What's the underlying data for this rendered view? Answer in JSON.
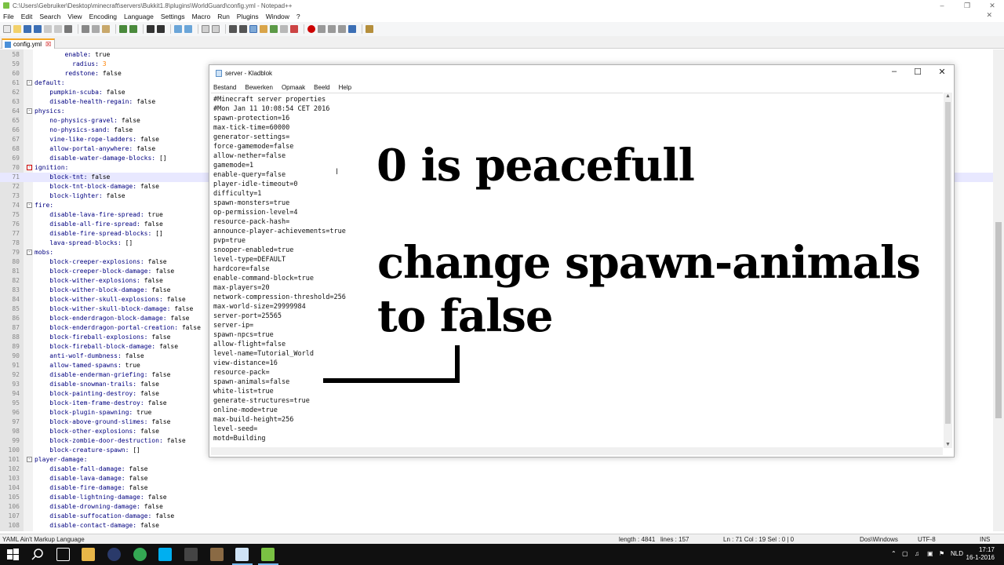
{
  "npp": {
    "title": "C:\\Users\\Gebruiker\\Desktop\\minecraft\\servers\\Bukkit1.8\\plugins\\WorldGuard\\config.yml - Notepad++",
    "menu": [
      "File",
      "Edit",
      "Search",
      "View",
      "Encoding",
      "Language",
      "Settings",
      "Macro",
      "Run",
      "Plugins",
      "Window",
      "?"
    ],
    "tab": "config.yml",
    "lines": [
      {
        "n": "58",
        "indent": "        ",
        "key": "enable",
        "val": "true",
        "type": "b"
      },
      {
        "n": "59",
        "indent": "          ",
        "key": "radius",
        "val": "3",
        "type": "num"
      },
      {
        "n": "60",
        "indent": "        ",
        "key": "redstone",
        "val": "false",
        "type": "b"
      },
      {
        "n": "61",
        "indent": "",
        "key": "default",
        "val": "",
        "fold": "-"
      },
      {
        "n": "62",
        "indent": "    ",
        "key": "pumpkin-scuba",
        "val": "false"
      },
      {
        "n": "63",
        "indent": "    ",
        "key": "disable-health-regain",
        "val": "false"
      },
      {
        "n": "64",
        "indent": "",
        "key": "physics",
        "val": "",
        "fold": "-"
      },
      {
        "n": "65",
        "indent": "    ",
        "key": "no-physics-gravel",
        "val": "false"
      },
      {
        "n": "66",
        "indent": "    ",
        "key": "no-physics-sand",
        "val": "false"
      },
      {
        "n": "67",
        "indent": "    ",
        "key": "vine-like-rope-ladders",
        "val": "false"
      },
      {
        "n": "68",
        "indent": "    ",
        "key": "allow-portal-anywhere",
        "val": "false"
      },
      {
        "n": "69",
        "indent": "    ",
        "key": "disable-water-damage-blocks",
        "val": "[]"
      },
      {
        "n": "70",
        "indent": "",
        "key": "ignition",
        "val": "",
        "fold": "-",
        "red": true
      },
      {
        "n": "71",
        "indent": "    ",
        "key": "block-tnt",
        "val": "false",
        "cur": true
      },
      {
        "n": "72",
        "indent": "    ",
        "key": "block-tnt-block-damage",
        "val": "false"
      },
      {
        "n": "73",
        "indent": "    ",
        "key": "block-lighter",
        "val": "false"
      },
      {
        "n": "74",
        "indent": "",
        "key": "fire",
        "val": "",
        "fold": "-"
      },
      {
        "n": "75",
        "indent": "    ",
        "key": "disable-lava-fire-spread",
        "val": "true"
      },
      {
        "n": "76",
        "indent": "    ",
        "key": "disable-all-fire-spread",
        "val": "false"
      },
      {
        "n": "77",
        "indent": "    ",
        "key": "disable-fire-spread-blocks",
        "val": "[]"
      },
      {
        "n": "78",
        "indent": "    ",
        "key": "lava-spread-blocks",
        "val": "[]"
      },
      {
        "n": "79",
        "indent": "",
        "key": "mobs",
        "val": "",
        "fold": "-"
      },
      {
        "n": "80",
        "indent": "    ",
        "key": "block-creeper-explosions",
        "val": "false"
      },
      {
        "n": "81",
        "indent": "    ",
        "key": "block-creeper-block-damage",
        "val": "false"
      },
      {
        "n": "82",
        "indent": "    ",
        "key": "block-wither-explosions",
        "val": "false"
      },
      {
        "n": "83",
        "indent": "    ",
        "key": "block-wither-block-damage",
        "val": "false"
      },
      {
        "n": "84",
        "indent": "    ",
        "key": "block-wither-skull-explosions",
        "val": "false"
      },
      {
        "n": "85",
        "indent": "    ",
        "key": "block-wither-skull-block-damage",
        "val": "false"
      },
      {
        "n": "86",
        "indent": "    ",
        "key": "block-enderdragon-block-damage",
        "val": "false"
      },
      {
        "n": "87",
        "indent": "    ",
        "key": "block-enderdragon-portal-creation",
        "val": "false"
      },
      {
        "n": "88",
        "indent": "    ",
        "key": "block-fireball-explosions",
        "val": "false"
      },
      {
        "n": "89",
        "indent": "    ",
        "key": "block-fireball-block-damage",
        "val": "false"
      },
      {
        "n": "90",
        "indent": "    ",
        "key": "anti-wolf-dumbness",
        "val": "false"
      },
      {
        "n": "91",
        "indent": "    ",
        "key": "allow-tamed-spawns",
        "val": "true"
      },
      {
        "n": "92",
        "indent": "    ",
        "key": "disable-enderman-griefing",
        "val": "false"
      },
      {
        "n": "93",
        "indent": "    ",
        "key": "disable-snowman-trails",
        "val": "false"
      },
      {
        "n": "94",
        "indent": "    ",
        "key": "block-painting-destroy",
        "val": "false"
      },
      {
        "n": "95",
        "indent": "    ",
        "key": "block-item-frame-destroy",
        "val": "false"
      },
      {
        "n": "96",
        "indent": "    ",
        "key": "block-plugin-spawning",
        "val": "true"
      },
      {
        "n": "97",
        "indent": "    ",
        "key": "block-above-ground-slimes",
        "val": "false"
      },
      {
        "n": "98",
        "indent": "    ",
        "key": "block-other-explosions",
        "val": "false"
      },
      {
        "n": "99",
        "indent": "    ",
        "key": "block-zombie-door-destruction",
        "val": "false"
      },
      {
        "n": "100",
        "indent": "    ",
        "key": "block-creature-spawn",
        "val": "[]"
      },
      {
        "n": "101",
        "indent": "",
        "key": "player-damage",
        "val": "",
        "fold": "-"
      },
      {
        "n": "102",
        "indent": "    ",
        "key": "disable-fall-damage",
        "val": "false"
      },
      {
        "n": "103",
        "indent": "    ",
        "key": "disable-lava-damage",
        "val": "false"
      },
      {
        "n": "104",
        "indent": "    ",
        "key": "disable-fire-damage",
        "val": "false"
      },
      {
        "n": "105",
        "indent": "    ",
        "key": "disable-lightning-damage",
        "val": "false"
      },
      {
        "n": "106",
        "indent": "    ",
        "key": "disable-drowning-damage",
        "val": "false"
      },
      {
        "n": "107",
        "indent": "    ",
        "key": "disable-suffocation-damage",
        "val": "false"
      },
      {
        "n": "108",
        "indent": "    ",
        "key": "disable-contact-damage",
        "val": "false"
      }
    ],
    "status": {
      "language": "YAML Ain't Markup Language",
      "length": "length : 4841",
      "lines": "lines : 157",
      "pos": "Ln : 71    Col : 19    Sel : 0 | 0",
      "eol": "Dos\\Windows",
      "enc": "UTF-8",
      "ins": "INS"
    }
  },
  "notepad": {
    "title": "server - Kladblok",
    "menu": [
      "Bestand",
      "Bewerken",
      "Opmaak",
      "Beeld",
      "Help"
    ],
    "lines": [
      "#Minecraft server properties",
      "#Mon Jan 11 10:08:54 CET 2016",
      "spawn-protection=16",
      "max-tick-time=60000",
      "generator-settings=",
      "force-gamemode=false",
      "allow-nether=false",
      "gamemode=1",
      "enable-query=false",
      "player-idle-timeout=0",
      "difficulty=1",
      "spawn-monsters=true",
      "op-permission-level=4",
      "resource-pack-hash=",
      "announce-player-achievements=true",
      "pvp=true",
      "snooper-enabled=true",
      "level-type=DEFAULT",
      "hardcore=false",
      "enable-command-block=true",
      "max-players=20",
      "network-compression-threshold=256",
      "max-world-size=29999984",
      "server-port=25565",
      "server-ip=",
      "spawn-npcs=true",
      "allow-flight=false",
      "level-name=Tutorial_World",
      "view-distance=16",
      "resource-pack=",
      "spawn-animals=false",
      "white-list=true",
      "generate-structures=true",
      "online-mode=true",
      "max-build-height=256",
      "level-seed=",
      "motd=Building"
    ]
  },
  "overlay": {
    "line1": "0 is peacefull",
    "line2": "change spawn-animals",
    "line3": "to false"
  },
  "taskbar": {
    "lang": "NLD",
    "time": "17:17",
    "date": "16-1-2016"
  }
}
